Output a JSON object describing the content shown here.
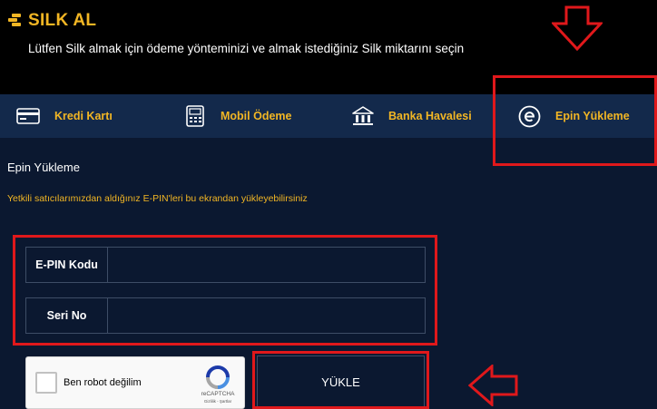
{
  "header": {
    "title": "SILK AL",
    "subtitle": "Lütfen Silk almak için ödeme yönteminizi ve almak istediğiniz Silk miktarını seçin"
  },
  "tabs": [
    {
      "label": "Kredi Kartı",
      "icon": "credit-card-icon"
    },
    {
      "label": "Mobil Ödeme",
      "icon": "mobile-payment-icon"
    },
    {
      "label": "Banka Havalesi",
      "icon": "bank-transfer-icon"
    },
    {
      "label": "Epin Yükleme",
      "icon": "epin-icon"
    }
  ],
  "section": {
    "title": "Epin Yükleme",
    "info": "Yetkili satıcılarımızdan aldığınız E-PIN'leri bu ekrandan yükleyebilirsiniz"
  },
  "form": {
    "epin_label": "E-PIN Kodu",
    "epin_value": "",
    "serial_label": "Seri No",
    "serial_value": ""
  },
  "captcha": {
    "label": "Ben robot değilim",
    "brand": "reCAPTCHA",
    "links": "Gizlilik - Şartlar"
  },
  "submit": {
    "label": "YÜKLE"
  },
  "colors": {
    "accent": "#f2b624",
    "background": "#0b1830",
    "tab_bar": "#13294b",
    "annotation": "#e0181b"
  }
}
